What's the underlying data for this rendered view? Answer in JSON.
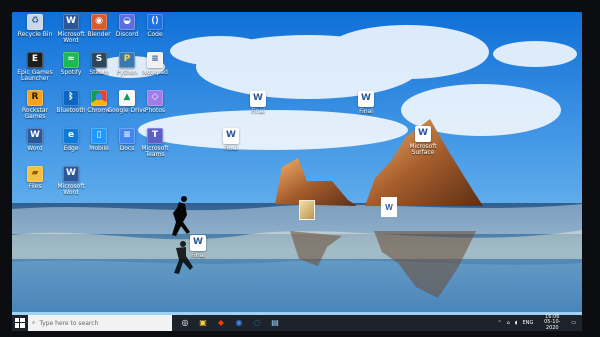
{
  "desktop": {
    "icons": [
      {
        "label": "Recycle Bin",
        "icon": "recycle-bin-icon",
        "color": "#c9d7e8"
      },
      {
        "label": "Microsoft Word",
        "icon": "word-icon",
        "color": "#2b579a"
      },
      {
        "label": "Blender",
        "icon": "blender-icon",
        "color": "#d85b30"
      },
      {
        "label": "Discord",
        "icon": "discord-icon",
        "color": "#5b6ee1"
      },
      {
        "label": "Code",
        "icon": "vscode-icon",
        "color": "#1f6fe5"
      },
      {
        "label": "Epic Games Launcher",
        "icon": "epic-games-icon",
        "color": "#1d1d1d"
      },
      {
        "label": "Spotify",
        "icon": "spotify-icon",
        "color": "#1db954"
      },
      {
        "label": "Steam",
        "icon": "steam-icon",
        "color": "#2a475e"
      },
      {
        "label": "Python",
        "icon": "python-icon",
        "color": "#3b78b0"
      },
      {
        "label": "Notepad",
        "icon": "notepad-icon",
        "color": "#f1f1f1"
      },
      {
        "label": "Rockstar Games",
        "icon": "rockstar-icon",
        "color": "#f6a21e"
      },
      {
        "label": "Bluetooth",
        "icon": "bluetooth-icon",
        "color": "#0a66c2"
      },
      {
        "label": "Chrome",
        "icon": "chrome-icon",
        "color": "#db4437"
      },
      {
        "label": "Google Drive",
        "icon": "drive-icon",
        "color": "#0f9d58"
      },
      {
        "label": "Photos",
        "icon": "photos-icon",
        "color": "#9f7ce7"
      },
      {
        "label": "Word",
        "icon": "word-icon",
        "color": "#2b579a"
      },
      {
        "label": "Edge",
        "icon": "edge-icon",
        "color": "#0c7bd8"
      },
      {
        "label": "Mobile",
        "icon": "phone-icon",
        "color": "#1f98ff"
      },
      {
        "label": "Docs",
        "icon": "docs-icon",
        "color": "#4285f4"
      },
      {
        "label": "Microsoft Teams",
        "icon": "teams-icon",
        "color": "#5b5fc7"
      },
      {
        "label": "Files",
        "icon": "folder-icon",
        "color": "#f3c03f"
      },
      {
        "label": "Microsoft Word",
        "icon": "word-icon",
        "color": "#2b579a"
      }
    ],
    "files": [
      {
        "label": "Final",
        "icon": "word-icon"
      },
      {
        "label": "Final",
        "icon": "word-icon"
      },
      {
        "label": "Final",
        "icon": "word-icon"
      },
      {
        "label": "Final",
        "icon": "word-icon"
      },
      {
        "label": "Microsoft Surface",
        "icon": "word-icon"
      },
      {
        "label": "",
        "icon": "image-icon"
      },
      {
        "label": "",
        "icon": "word-icon"
      }
    ]
  },
  "taskbar": {
    "search_placeholder": "Type here to search",
    "time": "16:06",
    "date": "05-10-2020",
    "lang": "ENG",
    "icons": [
      {
        "name": "search-icon",
        "glyph": "⌕"
      },
      {
        "name": "task-view-icon",
        "glyph": "◎"
      },
      {
        "name": "file-explorer-icon",
        "glyph": "▣"
      },
      {
        "name": "office-icon",
        "glyph": "◆"
      },
      {
        "name": "chrome-icon",
        "glyph": "◉"
      },
      {
        "name": "edge-icon",
        "glyph": "◌"
      },
      {
        "name": "microsoft-store-icon",
        "glyph": "▤"
      }
    ]
  }
}
